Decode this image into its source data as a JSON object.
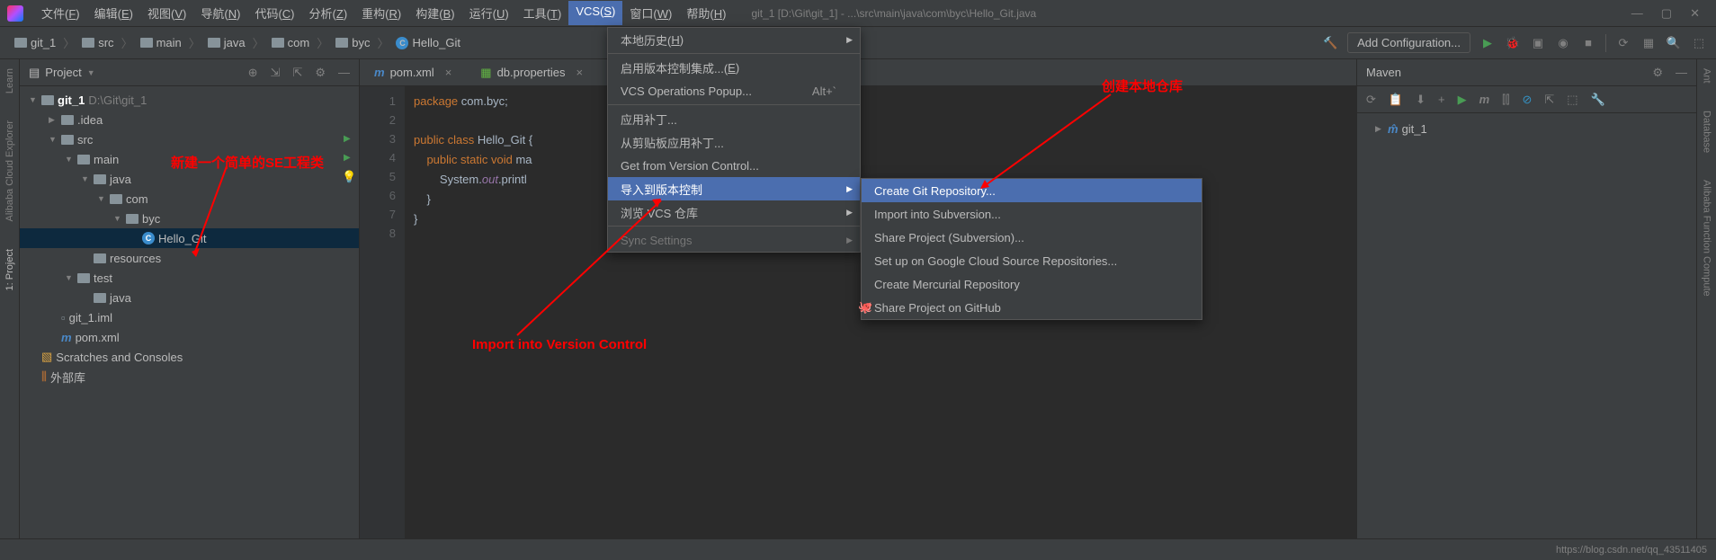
{
  "menubar": {
    "items": [
      "文件(F)",
      "编辑(E)",
      "视图(V)",
      "导航(N)",
      "代码(C)",
      "分析(Z)",
      "重构(R)",
      "构建(B)",
      "运行(U)",
      "工具(T)",
      "VCS(S)",
      "窗口(W)",
      "帮助(H)"
    ],
    "title_path": "git_1 [D:\\Git\\git_1] - ...\\src\\main\\java\\com\\byc\\Hello_Git.java"
  },
  "breadcrumb": [
    "git_1",
    "src",
    "main",
    "java",
    "com",
    "byc",
    "Hello_Git"
  ],
  "toolbar": {
    "config_label": "Add Configuration..."
  },
  "project": {
    "title": "Project",
    "root": {
      "name": "git_1",
      "path": "D:\\Git\\git_1"
    },
    "tree": [
      {
        "indent": 1,
        "arrow": "▶",
        "icon": "folder",
        "label": ".idea"
      },
      {
        "indent": 1,
        "arrow": "▼",
        "icon": "folder",
        "label": "src"
      },
      {
        "indent": 2,
        "arrow": "▼",
        "icon": "folder",
        "label": "main"
      },
      {
        "indent": 3,
        "arrow": "▼",
        "icon": "folder",
        "label": "java"
      },
      {
        "indent": 4,
        "arrow": "▼",
        "icon": "folder",
        "label": "com"
      },
      {
        "indent": 5,
        "arrow": "▼",
        "icon": "folder",
        "label": "byc"
      },
      {
        "indent": 6,
        "arrow": "",
        "icon": "java",
        "label": "Hello_Git",
        "selected": true
      },
      {
        "indent": 3,
        "arrow": "",
        "icon": "folder",
        "label": "resources"
      },
      {
        "indent": 2,
        "arrow": "▼",
        "icon": "folder",
        "label": "test"
      },
      {
        "indent": 3,
        "arrow": "",
        "icon": "folder",
        "label": "java"
      },
      {
        "indent": 1,
        "arrow": "",
        "icon": "file",
        "label": "git_1.iml"
      },
      {
        "indent": 1,
        "arrow": "",
        "icon": "maven",
        "label": "pom.xml"
      }
    ],
    "scratches": "Scratches and Consoles",
    "external": "外部库"
  },
  "editor": {
    "tabs": [
      {
        "label": "pom.xml",
        "icon": "maven",
        "active": false
      },
      {
        "label": "db.properties",
        "icon": "props",
        "active": false
      }
    ],
    "lines": [
      "1",
      "2",
      "3",
      "4",
      "5",
      "6",
      "7",
      "8"
    ],
    "code_package": "package",
    "code_pkg_name": " com.byc;",
    "code_public": "public",
    "code_class": " class",
    "code_classname": " Hello_Git {",
    "code_static": "    public static void",
    "code_main": " ma",
    "code_sysout": "        System.",
    "code_out": "out",
    "code_println": ".printl",
    "code_brace1": "    }",
    "code_brace2": "}"
  },
  "vcs_menu": {
    "items": [
      {
        "label": "本地历史(H)",
        "submenu": true
      },
      {
        "label": "启用版本控制集成...(E)"
      },
      {
        "label": "VCS Operations Popup...",
        "shortcut": "Alt+`"
      },
      {
        "label": "应用补丁..."
      },
      {
        "label": "从剪贴板应用补丁..."
      },
      {
        "label": "Get from Version Control..."
      },
      {
        "label": "导入到版本控制",
        "submenu": true,
        "highlighted": true
      },
      {
        "label": "浏览 VCS 仓库",
        "submenu": true
      },
      {
        "label": "Sync Settings",
        "disabled": true,
        "submenu": true
      }
    ]
  },
  "vcs_submenu": {
    "items": [
      {
        "label": "Create Git Repository...",
        "highlighted": true
      },
      {
        "label": "Import into Subversion..."
      },
      {
        "label": "Share Project (Subversion)..."
      },
      {
        "label": "Set up on Google Cloud Source Repositories..."
      },
      {
        "label": "Create Mercurial Repository"
      },
      {
        "label": "Share Project on GitHub",
        "icon": "github"
      }
    ]
  },
  "maven": {
    "title": "Maven",
    "root": "git_1"
  },
  "annotations": {
    "a1": "新建一个简单的SE工程类",
    "a2": "Import into Version Control",
    "a3": "创建本地仓库"
  },
  "left_gutter": [
    "Learn",
    "Alibaba Cloud Explorer",
    "1: Project"
  ],
  "right_gutter": [
    "Ant",
    "Database",
    "Alibaba Function Compute"
  ],
  "statusbar": {
    "watermark": "https://blog.csdn.net/qq_43511405"
  }
}
